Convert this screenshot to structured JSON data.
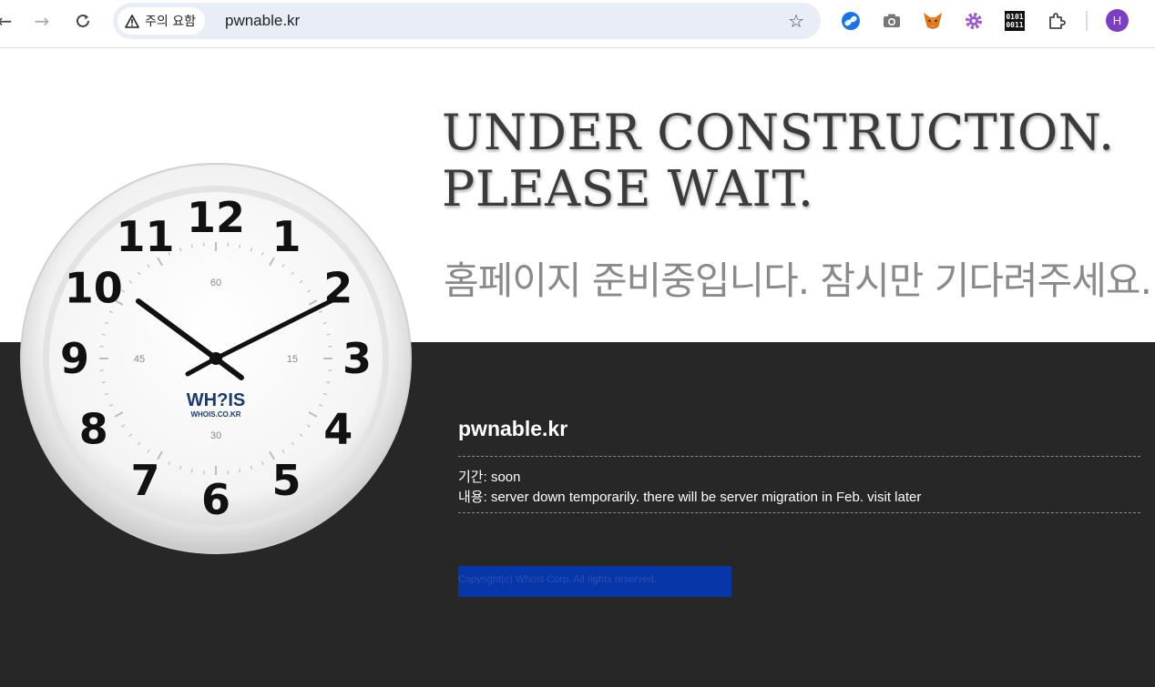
{
  "browser": {
    "security_label": "주의 요함",
    "url": "pwnable.kr",
    "profile_initial": "H",
    "extensions": [
      "link-icon",
      "camera-icon",
      "fox-icon",
      "gear-icon",
      "binary-icon",
      "puzzle-icon"
    ]
  },
  "page": {
    "headline_line1": "UNDER CONSTRUCTION.",
    "headline_line2": "PLEASE WAIT.",
    "korean_headline": "홈페이지 준비중입니다. 잠시만 기다려주세요.",
    "clock": {
      "numbers": [
        "12",
        "1",
        "2",
        "3",
        "4",
        "5",
        "6",
        "7",
        "8",
        "9",
        "10",
        "11"
      ],
      "inner_labels": [
        "60",
        "15",
        "30",
        "45"
      ],
      "brand": "WH?IS",
      "brand_url": "WHOIS.CO.KR"
    },
    "site_title": "pwnable.kr",
    "period_label": "기간",
    "period_value": ": soon",
    "content_label": "내용",
    "content_value": ": server down temporarily. there will be server migration in Feb. visit later",
    "copyright": "Copyright(c) WhoIs Corp. All rights reserved."
  },
  "colors": {
    "dark_bg": "#272727",
    "copyright_bg": "#0736a8",
    "avatar": "#7b3fc4"
  }
}
